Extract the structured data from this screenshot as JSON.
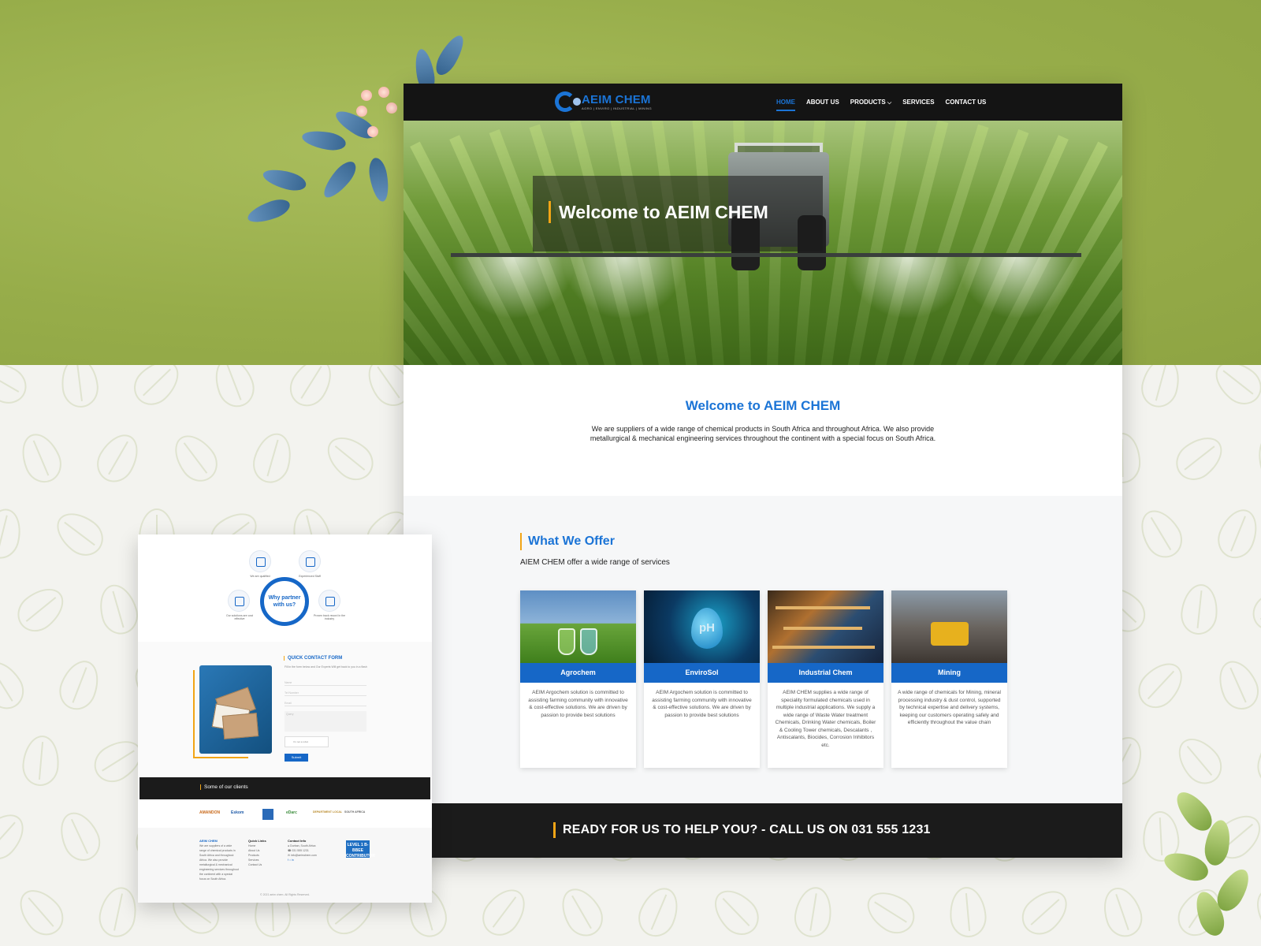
{
  "site": {
    "logo_name": "AEIM CHEM",
    "logo_tagline": "AGRO | ENVIRO | INDUSTRIAL | MINING",
    "nav": [
      "HOME",
      "ABOUT US",
      "PRODUCTS",
      "SERVICES",
      "CONTACT US"
    ],
    "active_nav": "HOME"
  },
  "hero": {
    "title": "Welcome to AEIM CHEM"
  },
  "welcome": {
    "title": "Welcome to AEIM CHEM",
    "body": "We are suppliers of a wide range of chemical products in South Africa and throughout Africa. We also provide metallurgical & mechanical engineering services throughout the continent with a special focus on South Africa."
  },
  "offer": {
    "title": "What We Offer",
    "subtitle": "AIEM CHEM offer a wide range of services",
    "cards": [
      {
        "label": "Agrochem",
        "text": "AEIM Argochem solution is committed to assisting farming community with innovative & cost-effective solutions. We are driven by passion to provide best solutions"
      },
      {
        "label": "EnviroSol",
        "text": "AEIM Argochem solution is committed to assisting farming community with innovative & cost-effective solutions. We are driven by passion to provide best solutions"
      },
      {
        "label": "Industrial Chem",
        "text": "AEIM CHEM supplies a wide range of speciality formulated chemicals used in multiple industrial applications. We supply a wide range of Waste Water treatment Chemicals, Drinking Water chemicals, Boiler & Cooling Tower chemicals, Descalants , Antiscalants, Biocides, Corrosion Inhibitors etc."
      },
      {
        "label": "Mining",
        "text": "A wide range of chemicals for Mining, mineral processing industry & dust control, supported by technical expertise and delivery systems, keeping our customers operating safely and efficiently throughout the value chain"
      }
    ]
  },
  "cta": {
    "text": "READY FOR US TO HELP YOU? - CALL US ON 031 555 1231"
  },
  "mini": {
    "why": {
      "center": "Why partner with us?",
      "nodes": [
        "We are qualified",
        "Experienced Staff",
        "Our solutions are cost effective",
        "Proven track record in the industry"
      ]
    },
    "form": {
      "title": "QUICK CONTACT FORM",
      "desc": "Fill in the form below and Our Experts Will get back to you in a flash",
      "fields": [
        "Name",
        "Tel Number",
        "Email"
      ],
      "message_placeholder": "Query",
      "captcha_label": "I'm not a robot",
      "submit": "Submit"
    },
    "clients_title": "Some of our clients",
    "client_logos": [
      "AMANDON",
      "Eskom",
      "eThekwini",
      "eDarc",
      "DEPARTMENT LOCAL",
      "SOUTH AFRICA"
    ],
    "footer": {
      "logo": "AEIM CHEM",
      "about": "We are suppliers of a wide range of chemical products in South Africa and throughout Africa. We also provide metallurgical & mechanical engineering services throughout the continent with a special focus on South Africa.",
      "quick_links_title": "Quick Links",
      "quick_links": [
        "Home",
        "About Us",
        "Products",
        "Services",
        "Contact Us"
      ],
      "contact_title": "Contact Info",
      "contact": [
        "Durban, South Africa",
        "031 555 1231",
        "info@aeimchem.com"
      ],
      "badge": "LEVEL 1 B-BBEE CONTRIBUTOR",
      "copyright": "© 2021 aeim chem. All Rights Reserved."
    }
  },
  "colors": {
    "brand_blue": "#1b74d6",
    "accent_orange": "#f2a516",
    "dark": "#141414",
    "backdrop_green": "#97ad4a"
  }
}
